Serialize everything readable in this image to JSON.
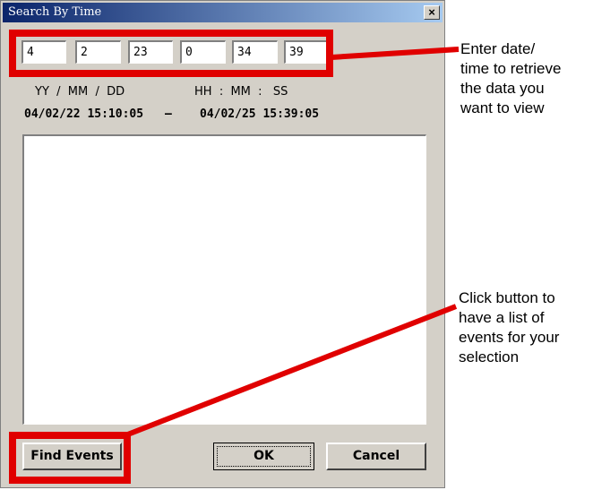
{
  "dialog": {
    "title": "Search By Time",
    "close_label": "×"
  },
  "fields": {
    "year": "4",
    "month": "2",
    "day": "23",
    "hour": "0",
    "minute": "34",
    "second": "39"
  },
  "labels": {
    "ymd": "YY  /  MM  /  DD",
    "hms": "HH  :  MM  :   SS"
  },
  "range": {
    "start": "04/02/22 15:10:05",
    "separator": "—",
    "end": "04/02/25 15:39:05"
  },
  "buttons": {
    "find_events": "Find Events",
    "ok": "OK",
    "cancel": "Cancel"
  },
  "annotations": {
    "top": [
      "Enter date/",
      "time to retrieve",
      "the data you",
      "want to view"
    ],
    "bottom": [
      "Click button to",
      "have a list of",
      "events for your",
      "selection"
    ]
  },
  "colors": {
    "highlight": "#e00000",
    "dialog_bg": "#d4d0c8"
  }
}
